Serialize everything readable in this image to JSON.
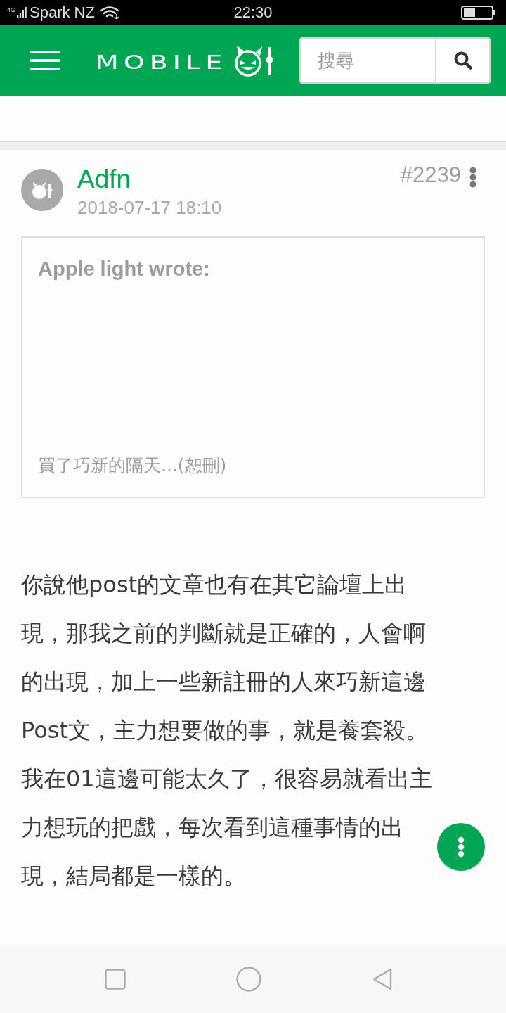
{
  "status_bar": {
    "network": "4G",
    "carrier": "Spark NZ",
    "time": "22:30"
  },
  "header": {
    "logo_text": "MOBILE",
    "search": {
      "placeholder": "搜尋"
    }
  },
  "post": {
    "author": "Adfn",
    "date": "2018-07-17 18:10",
    "number": "#2239",
    "quote": {
      "source": "Apple light wrote:",
      "excerpt": "買了巧新的隔天...(恕刪)"
    },
    "body": "你說他post的文章也有在其它論壇上出現，那我之前的判斷就是正確的，人會啊的出現，加上一些新註冊的人來巧新這邊Post文，主力想要做的事，就是養套殺。我在01這邊可能太久了，很容易就看出主力想玩的把戲，每次看到這種事情的出現，結局都是一樣的。"
  }
}
